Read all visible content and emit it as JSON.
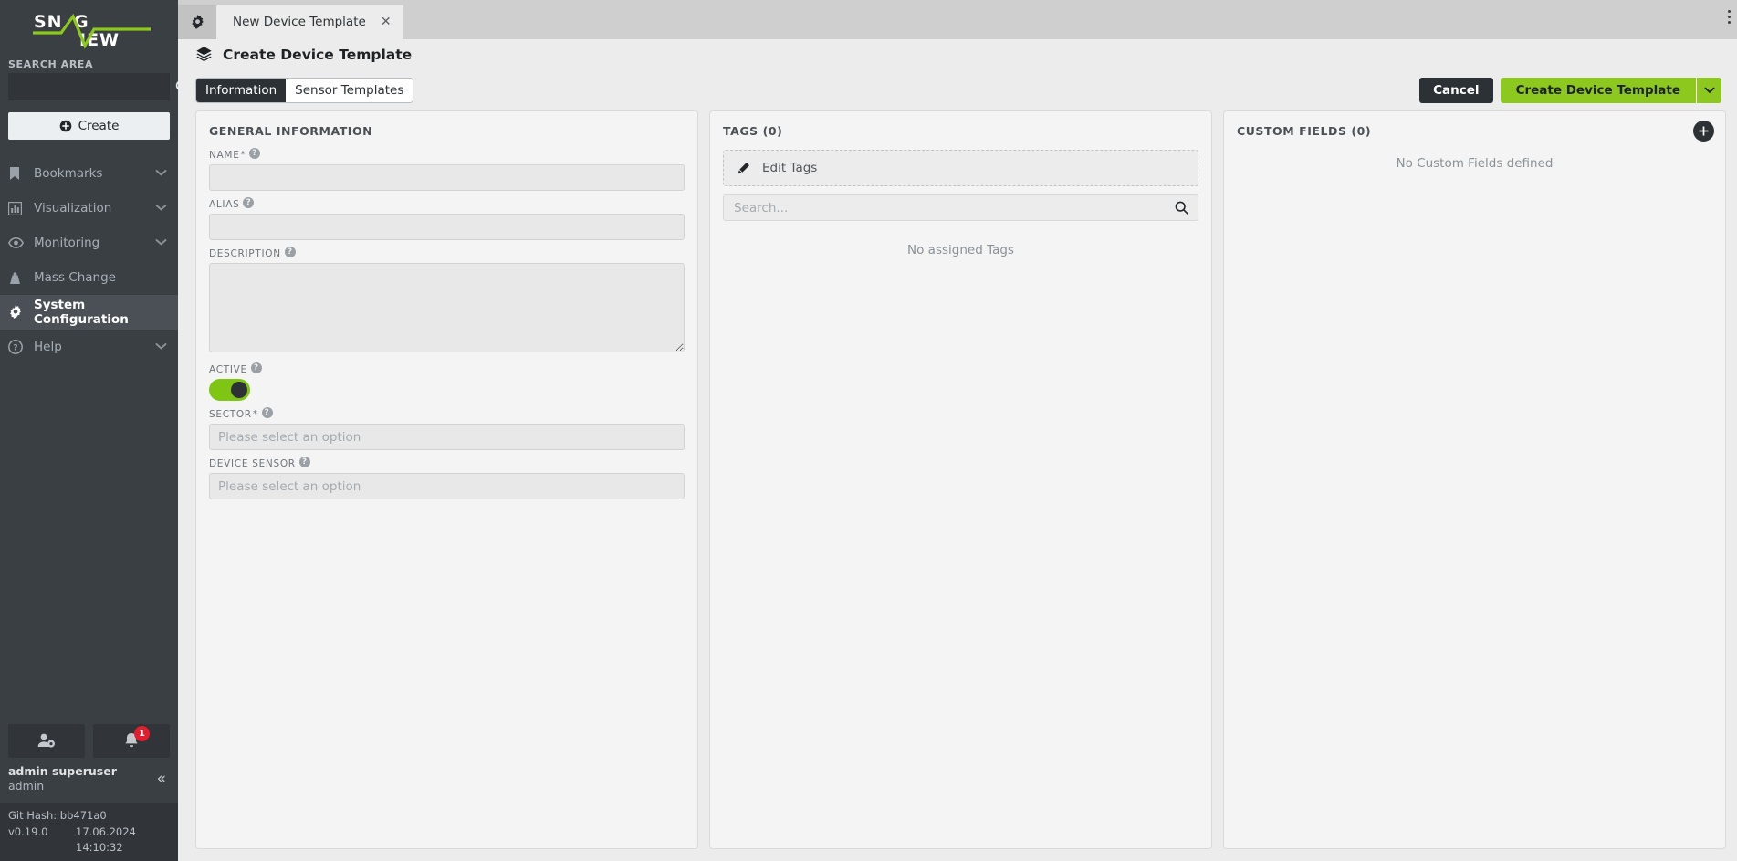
{
  "brand": {
    "logo_part1": "SN",
    "logo_part2": "G",
    "logo_part3": "IEW",
    "logo_full": "SNAGVIEW",
    "accent_green": "#8cc81e",
    "toggle_green": "#7ec514",
    "dark": "#3a3f44",
    "danger_red": "#e11d2e"
  },
  "sidebar": {
    "search_label": "SEARCH AREA",
    "search_value": "",
    "search_placeholder": "",
    "search_icon": "search-icon",
    "create_label": "Create",
    "create_icon": "plus-circle-icon",
    "items": [
      {
        "label": "Bookmarks",
        "icon": "bookmark-icon",
        "chevron": true,
        "active": false
      },
      {
        "label": "Visualization",
        "icon": "chart-icon",
        "chevron": true,
        "active": false
      },
      {
        "label": "Monitoring",
        "icon": "eye-icon",
        "chevron": true,
        "active": false
      },
      {
        "label": "Mass Change",
        "icon": "weight-icon",
        "chevron": false,
        "active": false
      },
      {
        "label": "System Configuration",
        "icon": "gear-icon",
        "chevron": false,
        "active": true
      },
      {
        "label": "Help",
        "icon": "question-icon",
        "chevron": true,
        "active": false
      }
    ],
    "user_settings_icon": "user-gear-icon",
    "notifications_icon": "bell-icon",
    "notification_count": "1",
    "user_name": "admin superuser",
    "user_role": "admin",
    "collapse_icon": "chevrons-left-icon",
    "collapse_label": "«",
    "footer": {
      "git_hash": "Git Hash: bb471a0",
      "version": "v0.19.0",
      "build_datetime": "17.06.2024 14:10:32"
    }
  },
  "tabbar": {
    "gear_tab_icon": "gear-icon",
    "tabs": [
      {
        "label": "New Device Template",
        "close_icon": "close-icon",
        "active": true
      }
    ],
    "overflow_icon": "kebab-menu-icon"
  },
  "page": {
    "icon": "layers-icon",
    "title": "Create Device Template"
  },
  "toolbar": {
    "segments": [
      {
        "label": "Information",
        "active": true
      },
      {
        "label": "Sensor Templates",
        "active": false
      }
    ],
    "cancel_label": "Cancel",
    "primary_label": "Create Device Template",
    "primary_caret_icon": "chevron-down-icon"
  },
  "general": {
    "title": "GENERAL INFORMATION",
    "fields": [
      {
        "label": "NAME",
        "required": true,
        "help": "help-icon",
        "type": "text",
        "value": "",
        "placeholder": ""
      },
      {
        "label": "ALIAS",
        "required": false,
        "help": "help-icon",
        "type": "text",
        "value": "",
        "placeholder": ""
      },
      {
        "label": "DESCRIPTION",
        "required": false,
        "help": "help-icon",
        "type": "textarea",
        "value": "",
        "placeholder": ""
      },
      {
        "label": "ACTIVE",
        "required": false,
        "help": "help-icon",
        "type": "toggle",
        "value": "on",
        "placeholder": ""
      },
      {
        "label": "SECTOR",
        "required": true,
        "help": "help-icon",
        "type": "select",
        "value": "",
        "placeholder": "Please select an option"
      },
      {
        "label": "DEVICE SENSOR",
        "required": false,
        "help": "help-icon",
        "type": "select",
        "value": "",
        "placeholder": "Please select an option"
      }
    ],
    "required_marker": "*"
  },
  "tags": {
    "title": "TAGS (0)",
    "count": 0,
    "edit_label": "Edit Tags",
    "edit_icon": "pencil-icon",
    "search_value": "",
    "search_placeholder": "Search...",
    "search_icon": "search-icon",
    "empty_text": "No assigned Tags"
  },
  "custom_fields": {
    "title": "CUSTOM FIELDS (0)",
    "count": 0,
    "add_icon": "plus-circle-icon",
    "add_label": "+",
    "empty_text": "No Custom Fields defined"
  }
}
